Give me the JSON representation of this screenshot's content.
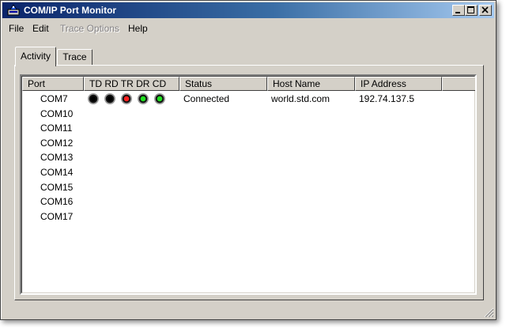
{
  "window": {
    "title": "COM/IP Port Monitor"
  },
  "menu": {
    "file": "File",
    "edit": "Edit",
    "trace_options": "Trace Options",
    "help": "Help"
  },
  "tabs": {
    "activity": "Activity",
    "trace": "Trace"
  },
  "columns": {
    "port": "Port",
    "signals": "TD RD TR DR CD",
    "status": "Status",
    "host": "Host Name",
    "ip": "IP Address"
  },
  "led_colors": {
    "off": "#000000",
    "red": "#ff2020",
    "green": "#20e020"
  },
  "rows": [
    {
      "port": "COM7",
      "status": "Connected",
      "host": "world.std.com",
      "ip": "192.74.137.5",
      "leds": [
        "off",
        "off",
        "red",
        "green",
        "green"
      ]
    },
    {
      "port": "COM10"
    },
    {
      "port": "COM11"
    },
    {
      "port": "COM12"
    },
    {
      "port": "COM13"
    },
    {
      "port": "COM14"
    },
    {
      "port": "COM15"
    },
    {
      "port": "COM16"
    },
    {
      "port": "COM17"
    }
  ]
}
